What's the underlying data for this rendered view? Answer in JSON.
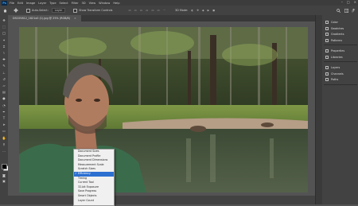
{
  "menubar": {
    "app_badge": "Ps",
    "items": [
      "File",
      "Edit",
      "Image",
      "Layer",
      "Type",
      "Select",
      "Filter",
      "3D",
      "View",
      "Window",
      "Help"
    ],
    "window_controls": [
      "–",
      "□",
      "×"
    ]
  },
  "options_bar": {
    "auto_select_label": "Auto-Select:",
    "auto_select_value": "Layer",
    "transform_label": "Show Transform Controls",
    "mode_label": "3D Mode:"
  },
  "document": {
    "tab_title": "DSC05812_1821x0 (1).jpg @ 25% (RGB/8)",
    "close_glyph": "×"
  },
  "toolbar": {
    "tools": [
      "move-tool",
      "marquee-tool",
      "lasso-tool",
      "magic-wand-tool",
      "crop-tool",
      "eyedropper-tool",
      "healing-brush-tool",
      "brush-tool",
      "clone-stamp-tool",
      "history-brush-tool",
      "eraser-tool",
      "gradient-tool",
      "blur-tool",
      "dodge-tool",
      "pen-tool",
      "type-tool",
      "path-selection-tool",
      "rectangle-tool",
      "hand-tool",
      "zoom-tool",
      "edit-toolbar-tool"
    ],
    "foreground_color": "#000000",
    "background_color": "#ffffff"
  },
  "right_panel": {
    "groups": [
      [
        "Color",
        "Swatches",
        "Gradients",
        "Patterns"
      ],
      [
        "Properties",
        "Libraries"
      ],
      [
        "Layers",
        "Channels",
        "Paths"
      ]
    ]
  },
  "context_menu": {
    "items": [
      "Document Sizes",
      "Document Profile",
      "Document Dimensions",
      "Measurement Scale",
      "Scratch Sizes",
      "Efficiency",
      "Timing",
      "Current Tool",
      "32-bit Exposure",
      "Save Progress",
      "Smart Objects",
      "Layer Count"
    ],
    "selected_index": 5,
    "check_glyph": "✓"
  },
  "colors": {
    "accent": "#31a8ff",
    "selection": "#2b6fd1",
    "workspace": "#535353",
    "panel": "#424242"
  }
}
